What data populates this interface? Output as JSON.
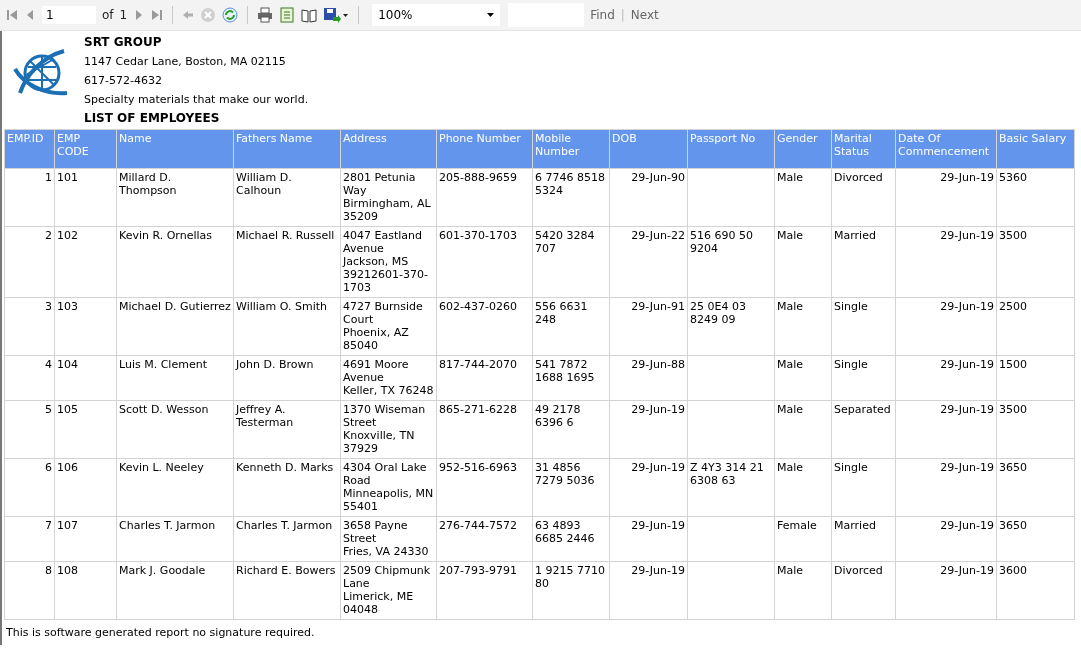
{
  "toolbar": {
    "page": "1",
    "of_label": "of",
    "page_count": "1",
    "zoom": "100%",
    "find_label": "Find",
    "separator": "|",
    "next_label": "Next"
  },
  "report": {
    "company": "SRT GROUP",
    "address": "1147 Cedar Lane, Boston, MA 02115",
    "phone": "617-572-4632",
    "tagline": "Specialty materials that make our world.",
    "title": "LIST OF EMPLOYEES",
    "columns": [
      "EMP.ID",
      "EMP CODE",
      "Name",
      "Fathers Name",
      "Address",
      "Phone Number",
      "Mobile Number",
      "DOB",
      "Passport No",
      "Gender",
      "Marital Status",
      "Date Of Commencement",
      "Basic Salary"
    ],
    "rows": [
      [
        "1",
        "101",
        "Millard D. Thompson",
        "William D. Calhoun",
        "2801 Petunia Way\nBirmingham, AL 35209",
        "205-888-9659",
        "6 7746 8518 5324",
        "29-Jun-90",
        "",
        "Male",
        "Divorced",
        "29-Jun-19",
        "5360"
      ],
      [
        "2",
        "102",
        "Kevin R. Ornellas",
        "Michael R. Russell",
        "4047 Eastland Avenue\nJackson, MS 39212601-370-1703",
        "601-370-1703",
        "5420 3284 707",
        "29-Jun-22",
        "516 690 50 9204",
        "Male",
        "Married",
        "29-Jun-19",
        "3500"
      ],
      [
        "3",
        "103",
        "Michael D. Gutierrez",
        "William O. Smith",
        "4727 Burnside Court\nPhoenix, AZ 85040",
        "602-437-0260",
        "556 6631 248",
        "29-Jun-91",
        "25 0E4 03 8249 09",
        "Male",
        "Single",
        "29-Jun-19",
        "2500"
      ],
      [
        "4",
        "104",
        "Luis M. Clement",
        "John D. Brown",
        "4691 Moore Avenue\nKeller, TX 76248",
        "817-744-2070",
        "541 7872 1688 1695",
        "29-Jun-88",
        "",
        "Male",
        "Single",
        "29-Jun-19",
        "1500"
      ],
      [
        "5",
        "105",
        "Scott D. Wesson",
        "Jeffrey A. Testerman",
        "1370 Wiseman Street\nKnoxville, TN 37929",
        "865-271-6228",
        "49 2178 6396 6",
        "29-Jun-19",
        "",
        "Male",
        "Separated",
        "29-Jun-19",
        "3500"
      ],
      [
        "6",
        "106",
        "Kevin L. Neeley",
        "Kenneth D. Marks",
        "4304 Oral Lake Road\nMinneapolis, MN 55401",
        "952-516-6963",
        "31 4856 7279 5036",
        "29-Jun-19",
        "Z 4Y3 314 21 6308 63",
        "Male",
        "Single",
        "29-Jun-19",
        "3650"
      ],
      [
        "7",
        "107",
        "Charles T. Jarmon",
        "Charles T. Jarmon",
        "3658 Payne Street\nFries, VA 24330",
        "276-744-7572",
        "63 4893 6685 2446",
        "29-Jun-19",
        "",
        "Female",
        "Married",
        "29-Jun-19",
        "3650"
      ],
      [
        "8",
        "108",
        "Mark J. Goodale",
        "Richard E. Bowers",
        "2509 Chipmunk Lane\nLimerick, ME 04048",
        "207-793-9791",
        "1 9215 7710 80",
        "29-Jun-19",
        "",
        "Male",
        "Divorced",
        "29-Jun-19",
        "3600"
      ]
    ],
    "footer": "This is software generated report no signature required."
  }
}
